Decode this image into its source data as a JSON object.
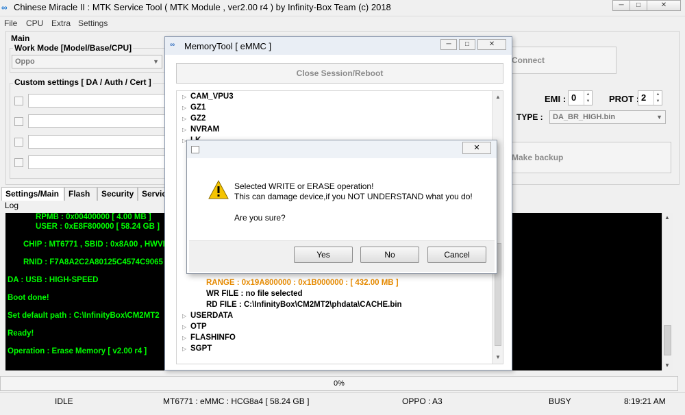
{
  "window": {
    "title": "Chinese Miracle II : MTK Service Tool ( MTK Module , ver2.00 r4 ) by Infinity-Box Team (c) 2018",
    "minimize": "─",
    "maximize": "□",
    "close": "✕"
  },
  "menu": [
    "File",
    "CPU",
    "Extra",
    "Settings"
  ],
  "main": {
    "group_label": "Main",
    "work_mode_label": "Work Mode [Model/Base/CPU]",
    "work_mode_value": "Oppo",
    "custom_label": "Custom settings [ DA / Auth / Cert ]",
    "connect_label": "Connect",
    "emi_label": "EMI :",
    "emi_value": "0",
    "prot_label": "PROT :",
    "prot_value": "2",
    "type_label": "TYPE :",
    "type_value": "DA_BR_HIGH.bin",
    "backup_label": "Make backup"
  },
  "tabs": [
    "Settings/Main",
    "Flash",
    "Security",
    "Service"
  ],
  "log_label": "Log",
  "log_lines": [
    "RPMB   : 0x00400000 [ 4.00 MB ]",
    "USER   : 0xE8F800000 [ 58.24 GB ]",
    "CHIP : MT6771 , SBID : 0x8A00 , HWVE",
    "RNID : F7A8A2C2A80125C4574C9065",
    "DA : USB : HIGH-SPEED",
    "Boot done!",
    "Set default path : C:\\InfinityBox\\CM2MT2",
    "Ready!",
    "Operation : Erase Memory [ v2.00 r4 ]"
  ],
  "progress": "0%",
  "status": {
    "state": "IDLE",
    "device": "MT6771 : eMMC : HCG8a4  [ 58.24 GB ]",
    "model": "OPPO : A3",
    "busy": "BUSY",
    "time": "8:19:21 AM"
  },
  "memtool": {
    "title": "MemoryTool [ eMMC ]",
    "close_session": "Close Session/Reboot",
    "tree_top": [
      "CAM_VPU3",
      "GZ1",
      "GZ2",
      "NVRAM",
      "LK"
    ],
    "range": "RANGE : 0x19A800000 : 0x1B000000 :  [ 432.00 MB ]",
    "wr_file": "WR FILE : no file selected",
    "rd_file": "RD FILE : C:\\InfinityBox\\CM2MT2\\phdata\\CACHE.bin",
    "tree_bottom": [
      "USERDATA",
      "OTP",
      "FLASHINFO",
      "SGPT"
    ]
  },
  "dialog": {
    "line1": "Selected WRITE or ERASE operation!",
    "line2": "This can damage device,if you NOT UNDERSTAND what you do!",
    "line3": "Are you sure?",
    "yes": "Yes",
    "no": "No",
    "cancel": "Cancel",
    "close": "✕"
  },
  "colors": {
    "log_bg": "#000000",
    "log_text": "#00ff00",
    "range_text": "#e68a00",
    "warning": "#f5c400"
  }
}
